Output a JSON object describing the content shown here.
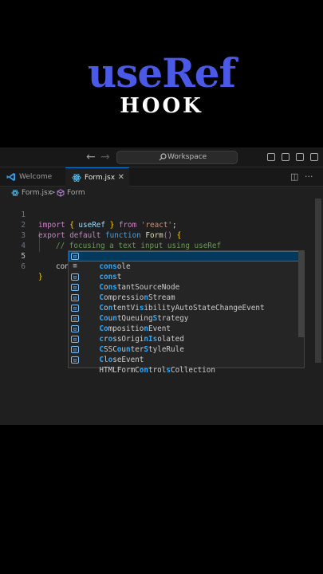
{
  "title": {
    "main": "useRef",
    "sub": "HOOK"
  },
  "titlebar": {
    "back": "←",
    "forward": "→",
    "search_label": "Workspace"
  },
  "tabs": [
    {
      "label": "Welcome"
    },
    {
      "label": "Form.jsx",
      "close": "✕"
    }
  ],
  "tab_actions": {
    "split": "◫",
    "more": "···"
  },
  "breadcrumb": {
    "file": "Form.jsx",
    "sep": ">",
    "symbol": "Form"
  },
  "code": {
    "lines": [
      {
        "num": "1"
      },
      {
        "num": "2"
      },
      {
        "num": "3"
      },
      {
        "num": "4"
      },
      {
        "num": "5"
      },
      {
        "num": "6"
      }
    ],
    "l1": {
      "import": "import",
      "open": "{",
      "name": "useRef",
      "close": "}",
      "from": "from",
      "str": "'react'",
      "semi": ";"
    },
    "l2": {
      "export": "export",
      "default": "default",
      "function": "function",
      "name": "Form",
      "parens": "()",
      "brace": "{"
    },
    "l3": {
      "comment": "// focusing a text input using useRef"
    },
    "l5": {
      "typed": "cons"
    },
    "l6": {
      "brace": "}"
    }
  },
  "suggestions": [
    {
      "match": "cons",
      "rest": "ole",
      "pre": "",
      "kind": "variable"
    },
    {
      "match": "cons",
      "rest": "t",
      "pre": "",
      "kind": "keyword"
    },
    {
      "match": "",
      "rest": "ConstantSourceNode",
      "pre": "",
      "kind": "variable"
    },
    {
      "match": "",
      "rest": "CompressionStream",
      "pre": "",
      "kind": "variable"
    },
    {
      "match": "",
      "rest": "ContentVisibilityAutoStateChangeEvent",
      "pre": "",
      "kind": "variable"
    },
    {
      "match": "",
      "rest": "CountQueuingStrategy",
      "pre": "",
      "kind": "variable"
    },
    {
      "match": "",
      "rest": "CompositionEvent",
      "pre": "",
      "kind": "variable"
    },
    {
      "match": "",
      "rest": "crossOriginIsolated",
      "pre": "",
      "kind": "variable"
    },
    {
      "match": "",
      "rest": "CSSCounterStyleRule",
      "pre": "",
      "kind": "variable"
    },
    {
      "match": "",
      "rest": "CloseEvent",
      "pre": "",
      "kind": "variable"
    },
    {
      "match": "",
      "rest": "HTMLFormControlsCollection",
      "pre": "",
      "kind": "variable"
    }
  ],
  "icons": {
    "variable": "[⊚]",
    "keyword": "≡"
  },
  "colors": {
    "accent": "#0078d4",
    "title": "#4b5ae6",
    "match": "#2aaaff"
  }
}
